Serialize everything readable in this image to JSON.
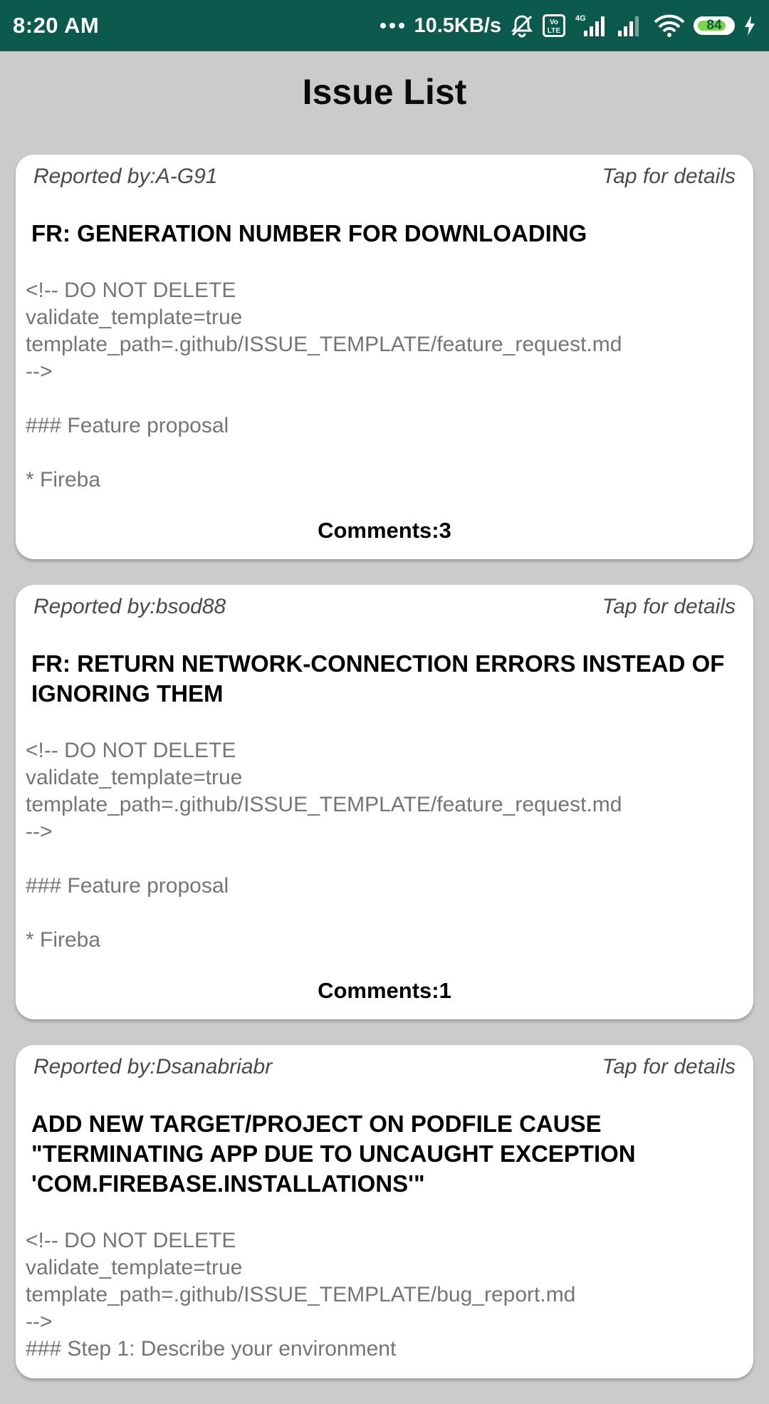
{
  "status_bar": {
    "time": "8:20 AM",
    "network_speed": "10.5KB/s",
    "volte_label": "Vo LTE",
    "network_type": "4G",
    "battery_level": "84",
    "battery_fraction": 0.84,
    "icons": [
      "more-dots-icon",
      "mute-bell-icon",
      "volte-icon",
      "signal-4g-icon",
      "signal-icon",
      "wifi-icon",
      "battery-icon",
      "charging-icon"
    ]
  },
  "page": {
    "title": "Issue List"
  },
  "issues": [
    {
      "reporter": "Reported by:A-G91",
      "tap_label": "Tap for details",
      "title": "FR: GENERATION NUMBER FOR DOWNLOADING",
      "body": "<!-- DO NOT DELETE\nvalidate_template=true\ntemplate_path=.github/ISSUE_TEMPLATE/feature_request.md\n-->\n\n### Feature proposal\n\n* Fireba",
      "comments": "Comments:3"
    },
    {
      "reporter": "Reported by:bsod88",
      "tap_label": "Tap for details",
      "title": "FR: RETURN NETWORK-CONNECTION ERRORS INSTEAD OF IGNORING THEM",
      "body": "<!-- DO NOT DELETE\nvalidate_template=true\ntemplate_path=.github/ISSUE_TEMPLATE/feature_request.md\n-->\n\n### Feature proposal\n\n* Fireba",
      "comments": "Comments:1"
    },
    {
      "reporter": "Reported by:Dsanabriabr",
      "tap_label": "Tap for details",
      "title": "ADD NEW TARGET/PROJECT ON PODFILE CAUSE \"TERMINATING APP DUE TO UNCAUGHT EXCEPTION 'COM.FIREBASE.INSTALLATIONS'\"",
      "body": "<!-- DO NOT DELETE\nvalidate_template=true\ntemplate_path=.github/ISSUE_TEMPLATE/bug_report.md\n-->\n### Step 1: Describe your environment",
      "comments": ""
    }
  ],
  "colors": {
    "status_bar": "#0c5a4d",
    "background": "#cbcbcb",
    "card": "#ffffff",
    "body_text": "#757575",
    "battery_fill": "#7fd34a"
  }
}
